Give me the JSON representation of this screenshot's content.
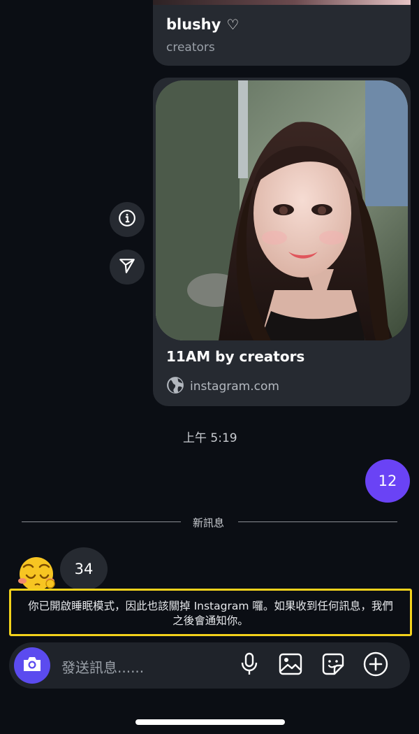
{
  "top_card": {
    "title": "blushy",
    "subtitle": "creators"
  },
  "link_card": {
    "title": "11AM by creators",
    "domain": "instagram.com"
  },
  "side_actions": {
    "info_icon": "info-circle-icon",
    "share_icon": "send-icon"
  },
  "timestamp": "上午 5:19",
  "sent_message": {
    "text": "12"
  },
  "new_messages_divider": "新訊息",
  "received_message": {
    "text": "34"
  },
  "sleep_mode_notice": "你已開啟睡眠模式，因此也該關掉 Instagram 囉。如果收到任何訊息，我們之後會通知你。",
  "composer": {
    "placeholder": "發送訊息......",
    "tools": [
      "microphone-icon",
      "gallery-icon",
      "sticker-icon",
      "plus-icon"
    ]
  },
  "colors": {
    "background": "#0b0e14",
    "card": "#262a31",
    "sent_bubble": "#6a43f5",
    "camera_button": "#5b4bef",
    "notice_border": "#f3d21b"
  }
}
